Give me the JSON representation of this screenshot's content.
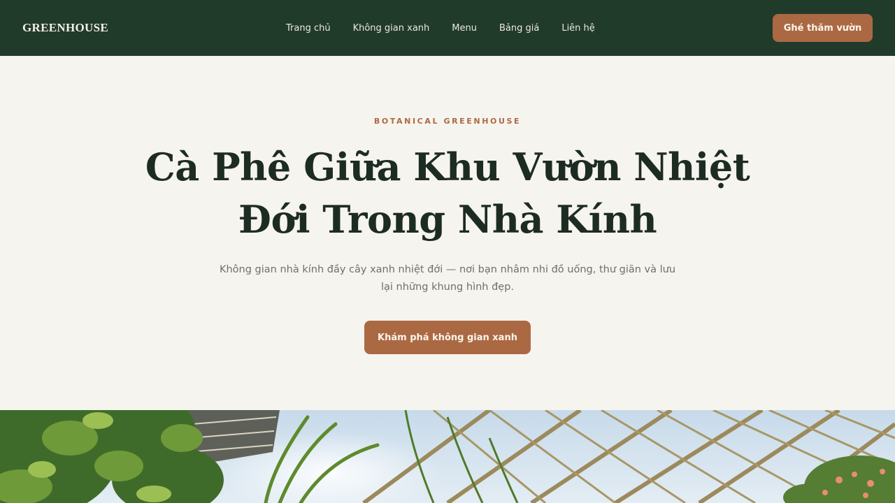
{
  "navbar": {
    "logo": "GREENHOUSE",
    "links": [
      "Trang chủ",
      "Không gian xanh",
      "Menu",
      "Bảng giá",
      "Liên hệ"
    ],
    "cta_label": "Ghé thăm vườn"
  },
  "hero": {
    "eyebrow": "BOTANICAL GREENHOUSE",
    "title_line1": "Cà Phê Giữa Khu Vườn Nhiệt",
    "title_line2": "Đới Trong Nhà Kính",
    "subtitle_line1": "Không gian nhà kính đầy cây xanh nhiệt đới — nơi bạn nhâm nhi đồ uống, thư giãn và lưu",
    "subtitle_line2": "lại những khung hình đẹp.",
    "cta_label": "Khám phá không gian xanh"
  },
  "colors": {
    "nav_bg": "#213b2b",
    "accent": "#ab6943",
    "page_bg": "#f6f4ef",
    "heading": "#1d2c22",
    "body_text": "#6d706b"
  }
}
